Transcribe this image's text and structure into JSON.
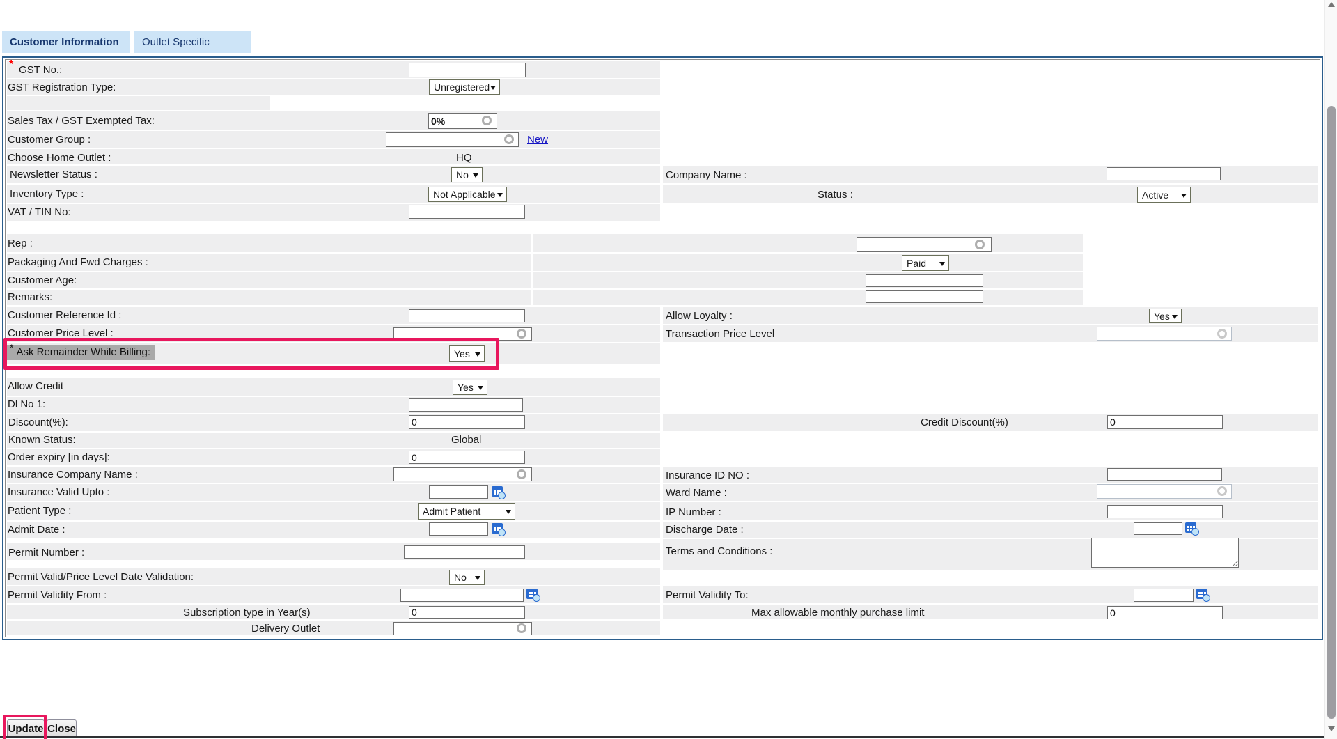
{
  "colors": {
    "highlight": "#e8175d",
    "tab_bg": "#cde4f7",
    "tab_text": "#17376e",
    "row_bg": "#eeeeef",
    "link": "#1515c4",
    "label_selection": "#a9a9a9"
  },
  "tabs": [
    {
      "label": "Customer Information"
    },
    {
      "label": "Outlet Specific"
    }
  ],
  "fields": {
    "gst_no": {
      "required": "*",
      "label": "GST No.:",
      "value": ""
    },
    "gst_registration_type": {
      "label": "GST Registration Type:",
      "value": "Unregistered"
    },
    "sales_tax": {
      "label": "Sales Tax / GST Exempted Tax:",
      "value": "0%"
    },
    "customer_group": {
      "label": "Customer Group :",
      "value": "",
      "new_link": "New"
    },
    "choose_home_outlet": {
      "label": "Choose Home Outlet :",
      "value": "HQ"
    },
    "newsletter_status": {
      "label": "Newsletter Status :",
      "value": "No"
    },
    "company_name": {
      "label": "Company Name :",
      "value": ""
    },
    "inventory_type": {
      "label": "Inventory Type :",
      "value": "Not Applicable"
    },
    "status": {
      "label": "Status :",
      "value": "Active"
    },
    "vat_tin_no": {
      "label": "VAT / TIN No:",
      "value": ""
    },
    "rep": {
      "label": "Rep :",
      "value": ""
    },
    "packaging_fwd_charges": {
      "label": "Packaging And Fwd Charges :",
      "value": "Paid"
    },
    "customer_age": {
      "label": "Customer Age:",
      "value": ""
    },
    "remarks": {
      "label": "Remarks:",
      "value": ""
    },
    "customer_reference_id": {
      "label": "Customer Reference Id :",
      "value": ""
    },
    "allow_loyalty": {
      "label": "Allow Loyalty :",
      "value": "Yes"
    },
    "customer_price_level": {
      "label": "Customer Price Level :",
      "value": ""
    },
    "transaction_price_level": {
      "label": "Transaction Price Level",
      "value": ""
    },
    "ask_remainder_while_billing": {
      "required": "*",
      "label": "Ask Remainder While Billing:",
      "value": "Yes"
    },
    "allow_credit": {
      "label": "Allow Credit",
      "value": "Yes"
    },
    "dl_no_1": {
      "label": "Dl No 1:",
      "value": ""
    },
    "discount": {
      "label": "Discount(%):",
      "value": "0"
    },
    "credit_discount": {
      "label": "Credit Discount(%)",
      "value": "0"
    },
    "known_status": {
      "label": "Known Status:",
      "value": "Global"
    },
    "order_expiry": {
      "label": "Order expiry [in days]:",
      "value": "0"
    },
    "insurance_company_name": {
      "label": "Insurance Company Name :",
      "value": ""
    },
    "insurance_id_no": {
      "label": "Insurance ID NO :",
      "value": ""
    },
    "insurance_valid_upto": {
      "label": "Insurance Valid Upto :",
      "value": ""
    },
    "ward_name": {
      "label": "Ward Name :",
      "value": ""
    },
    "patient_type": {
      "label": "Patient Type :",
      "value": "Admit Patient"
    },
    "ip_number": {
      "label": "IP Number :",
      "value": ""
    },
    "admit_date": {
      "label": "Admit Date :",
      "value": ""
    },
    "discharge_date": {
      "label": "Discharge Date :",
      "value": ""
    },
    "permit_number": {
      "label": "Permit Number :",
      "value": ""
    },
    "terms_and_conditions": {
      "label": "Terms and Conditions :",
      "value": ""
    },
    "permit_valid_date_validation": {
      "label": "Permit Valid/Price Level Date Validation:",
      "value": "No"
    },
    "permit_validity_from": {
      "label": "Permit Validity From :",
      "value": ""
    },
    "permit_validity_to": {
      "label": "Permit Validity To:",
      "value": ""
    },
    "subscription_type_years": {
      "label": "Subscription type in Year(s)",
      "value": "0"
    },
    "max_monthly_purchase_limit": {
      "label": "Max allowable monthly purchase limit",
      "value": "0"
    },
    "delivery_outlet": {
      "label": "Delivery Outlet",
      "value": ""
    }
  },
  "footer": {
    "update_label": "Update",
    "close_label": "Close"
  }
}
